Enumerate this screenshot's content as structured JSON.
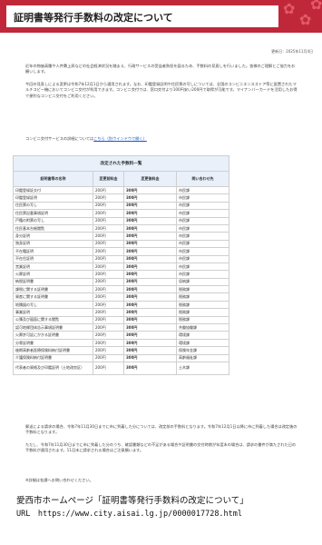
{
  "header": {
    "title": "証明書等発行手数料の改定について"
  },
  "updated": "更新日：2025年11月4日",
  "intro": [
    "近年の物価高騰や人件費上昇などの社会経済状況を踏まえ、行政サービスの受益者負担を図るため、手数料の見直しを行いました。皆様のご理解とご協力をお願いします。",
    "今回の見直しによる変更は令和7年12月1日から適用されます。なお、印鑑登録証明や住民票の写しについては、全国のコンビニエンスストア等に設置されたマルチコピー機においてコンビニ交付が利用できます。コンビニ交付では、窓口交付より100円安い200円で取得が可能です。マイナンバーカードを活用したお得で便利なコンビニ交付をご利用ください。"
  ],
  "link_line": {
    "prefix": "コンビニ交付サービスの詳細については",
    "link": "こちら（別ウインドウで開く）"
  },
  "table": {
    "caption": "改定された手数料一覧",
    "headers": [
      "証明書等の名称",
      "変更前料金",
      "変更後料金",
      "問い合わせ先"
    ],
    "rows": [
      [
        "印鑑登録証交付",
        "200円",
        "300円",
        "市民課"
      ],
      [
        "印鑑登録証明",
        "200円",
        "300円",
        "市民課"
      ],
      [
        "住民票の写し",
        "200円",
        "300円",
        "市民課"
      ],
      [
        "住民票記載事項証明",
        "200円",
        "300円",
        "市民課"
      ],
      [
        "戸籍の附票の写し",
        "200円",
        "300円",
        "市民課"
      ],
      [
        "住民基本台帳閲覧",
        "200円",
        "300円",
        "市民課"
      ],
      [
        "身分証明",
        "200円",
        "300円",
        "市民課"
      ],
      [
        "独身証明",
        "200円",
        "300円",
        "市民課"
      ],
      [
        "不在籍証明",
        "200円",
        "300円",
        "市民課"
      ],
      [
        "不在住証明",
        "200円",
        "300円",
        "市民課"
      ],
      [
        "営業証明",
        "200円",
        "300円",
        "市民課"
      ],
      [
        "火葬証明",
        "200円",
        "300円",
        "市民課"
      ],
      [
        "納税証明書",
        "200円",
        "300円",
        "収納課"
      ],
      [
        "課税に関する証明書",
        "200円",
        "300円",
        "税務課"
      ],
      [
        "資産に関する証明書",
        "200円",
        "300円",
        "税務課"
      ],
      [
        "地積図の写し",
        "200円",
        "300円",
        "税務課"
      ],
      [
        "事業証明",
        "200円",
        "300円",
        "税務課"
      ],
      [
        "公簿及び図面に関する閲覧",
        "200円",
        "300円",
        "税務課"
      ],
      [
        "認可地縁団体告示事項証明書",
        "200円",
        "300円",
        "共働協働課"
      ],
      [
        "火葬許可証にかかる証明書",
        "200円",
        "300円",
        "環境課"
      ],
      [
        "分骨証明書",
        "200円",
        "300円",
        "環境課"
      ],
      [
        "後期高齢者医療保険料納付証明書",
        "200円",
        "300円",
        "保険年金課"
      ],
      [
        "介護保険料納付証明書",
        "200円",
        "300円",
        "高齢福祉課"
      ],
      [
        "代表者の資格及び印鑑証明（土地改良区）",
        "200円",
        "300円",
        "土木課"
      ]
    ]
  },
  "after": [
    "郵送による請求の場合、令和7年11月30日までに市に到着した分については、改定前の手数料となります。令和7年12月1日以降に市に到着した場合は改定後の手数料となります。",
    "ただし、令和7年11月30日までに市に到着した分のうち、確認書類などの不足がある場合や証明書の交付時期が年度末の場合は、請求の書件が満たされた日の手数料が適用されます。11月末に請求される場合はご注意願います。"
  ],
  "note": "※詳細は各課へお問い合わせください。",
  "footer": {
    "line1": "愛西市ホームページ「証明書等発行手数料の改定について」",
    "line2": "URL　https://www.city.aisai.lg.jp/0000017728.html"
  },
  "colors": {
    "brand": "#c0283a",
    "table_header_bg": "#e9f0fa",
    "link": "#1a56c4"
  }
}
